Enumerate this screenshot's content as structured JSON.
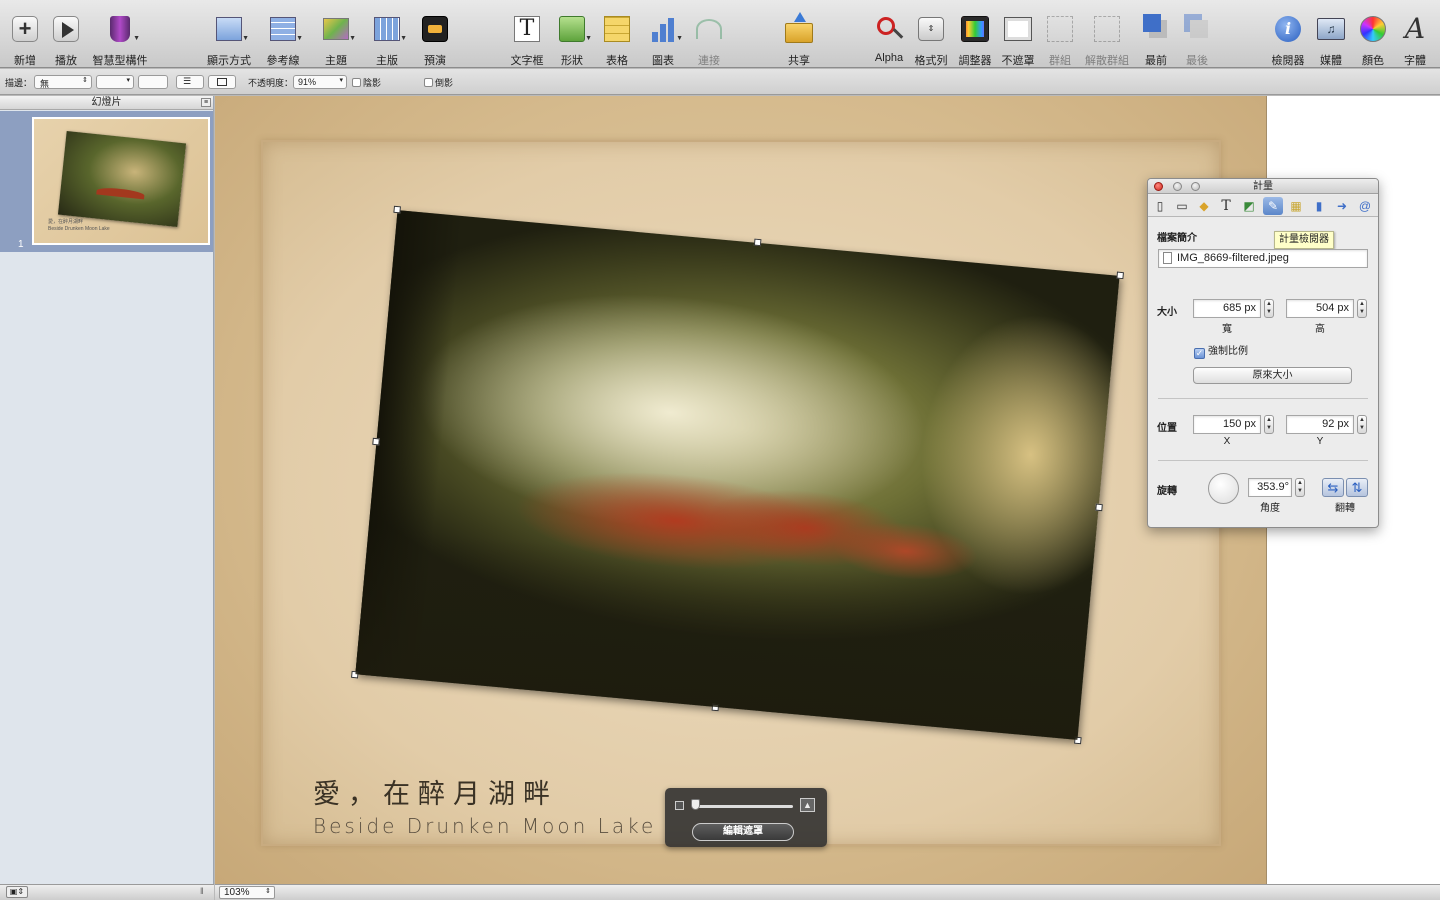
{
  "toolbar": {
    "items": [
      {
        "label": "新增",
        "icon": "plus-icon"
      },
      {
        "label": "播放",
        "icon": "play-icon"
      },
      {
        "label": "智慧型構件",
        "icon": "smart-build-icon"
      },
      {
        "label": "顯示方式",
        "icon": "view-icon"
      },
      {
        "label": "參考線",
        "icon": "guides-icon"
      },
      {
        "label": "主題",
        "icon": "themes-icon"
      },
      {
        "label": "主版",
        "icon": "masters-icon"
      },
      {
        "label": "預演",
        "icon": "rehearse-icon"
      },
      {
        "label": "文字框",
        "icon": "text-box-icon"
      },
      {
        "label": "形狀",
        "icon": "shapes-icon"
      },
      {
        "label": "表格",
        "icon": "table-icon"
      },
      {
        "label": "圖表",
        "icon": "chart-icon"
      },
      {
        "label": "連接",
        "icon": "connect-icon"
      },
      {
        "label": "共享",
        "icon": "share-icon"
      },
      {
        "label": "Alpha",
        "icon": "alpha-icon"
      },
      {
        "label": "格式列",
        "icon": "format-bar-icon"
      },
      {
        "label": "調整器",
        "icon": "adjust-icon"
      },
      {
        "label": "不遮罩",
        "icon": "unmask-icon"
      },
      {
        "label": "群組",
        "icon": "group-icon"
      },
      {
        "label": "解散群組",
        "icon": "ungroup-icon"
      },
      {
        "label": "最前",
        "icon": "front-icon"
      },
      {
        "label": "最後",
        "icon": "back-icon"
      },
      {
        "label": "檢閱器",
        "icon": "inspector-icon"
      },
      {
        "label": "媒體",
        "icon": "media-icon"
      },
      {
        "label": "顏色",
        "icon": "colors-icon"
      },
      {
        "label": "字體",
        "icon": "fonts-icon"
      }
    ]
  },
  "formatbar": {
    "stroke_label": "描邊：",
    "stroke_value": "無",
    "opacity_label": "不透明度：",
    "opacity_value": "91%",
    "shadow_label": "陰影",
    "reflection_label": "倒影"
  },
  "sidebar": {
    "title": "幻燈片",
    "slide_number": "1",
    "thumb_caption_cn": "愛，在醉月湖畔",
    "thumb_caption_en": "Beside Drunken Moon Lake"
  },
  "slide": {
    "caption_cn": "愛，在醉月湖畔",
    "caption_en": "Beside Drunken Moon Lake"
  },
  "mask_hud": {
    "edit_mask_label": "編輯遮罩"
  },
  "inspector": {
    "title": "計量",
    "tooltip": "計量檢閱器",
    "file_info_label": "檔案簡介",
    "file_name": "IMG_8669-filtered.jpeg",
    "size_label": "大小",
    "width_value": "685 px",
    "width_label": "寬",
    "height_value": "504 px",
    "height_label": "高",
    "constrain_label": "強制比例",
    "original_size_label": "原來大小",
    "position_label": "位置",
    "x_value": "150 px",
    "x_label": "X",
    "y_value": "92 px",
    "y_label": "Y",
    "rotate_label": "旋轉",
    "angle_value": "353.9°",
    "angle_label": "角度",
    "flip_label": "翻轉"
  },
  "statusbar": {
    "zoom_value": "103%"
  },
  "colors": {
    "selection": "#8d9fc1",
    "inspector_tab_active": "#5b86c9",
    "umbrella_red": "#b4381e"
  }
}
